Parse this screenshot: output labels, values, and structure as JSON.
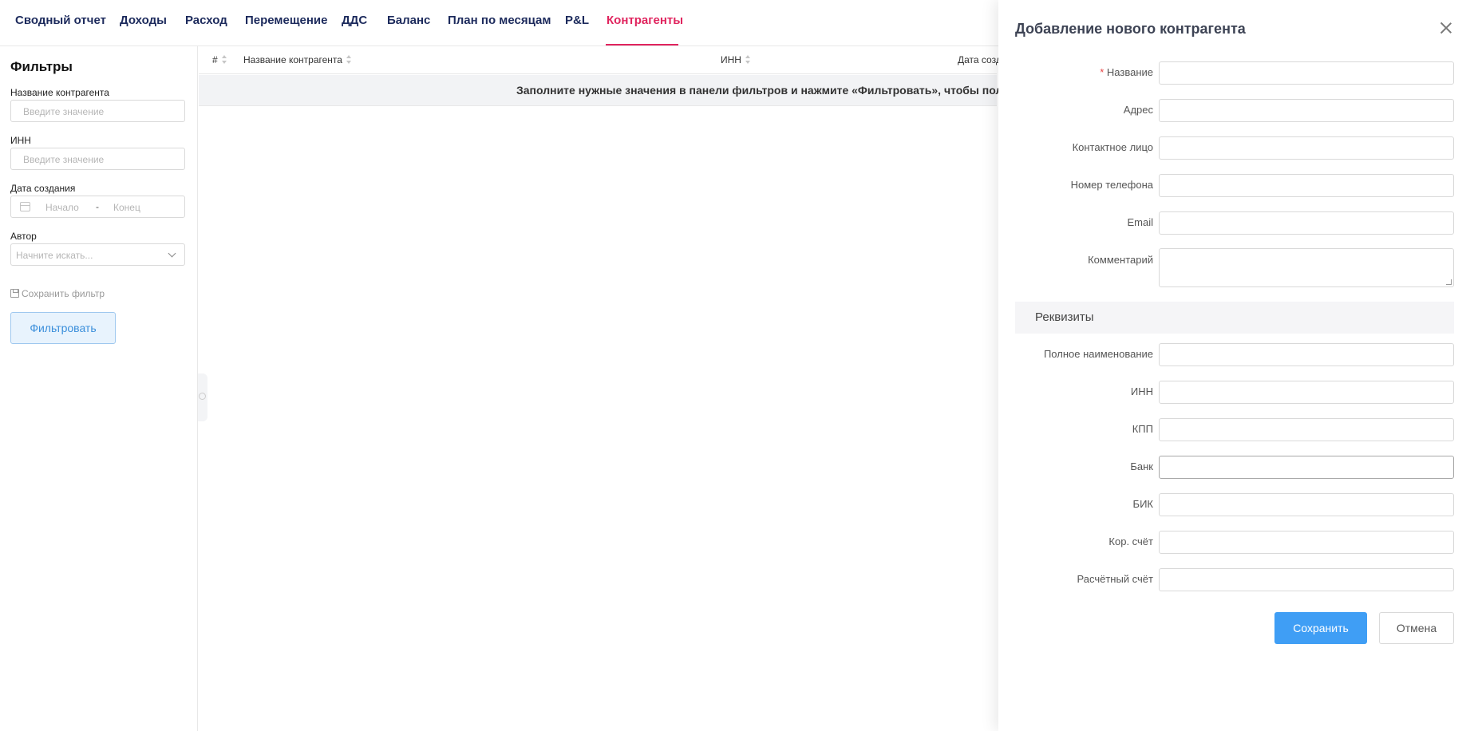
{
  "nav": {
    "tabs": [
      {
        "label": "Сводный отчет"
      },
      {
        "label": "Доходы"
      },
      {
        "label": "Расход"
      },
      {
        "label": "Перемещение"
      },
      {
        "label": "ДДС"
      },
      {
        "label": "Баланс"
      },
      {
        "label": "План по месяцам"
      },
      {
        "label": "P&L"
      },
      {
        "label": "Контрагенты"
      }
    ],
    "active_tab": "Контрагенты",
    "active_color": "#e0245e"
  },
  "filters": {
    "title": "Фильтры",
    "name_label": "Название контрагента",
    "name_placeholder": "Введите значение",
    "inn_label": "ИНН",
    "inn_placeholder": "Введите значение",
    "date_label": "Дата создания",
    "date_start_placeholder": "Начало",
    "date_separator": "-",
    "date_end_placeholder": "Конец",
    "author_label": "Автор",
    "author_placeholder": "Начните искать...",
    "save_filter_label": "Сохранить фильтр",
    "filter_button": "Фильтровать"
  },
  "table": {
    "columns": [
      "#",
      "Название контрагента",
      "ИНН",
      "Дата созд"
    ],
    "empty_message": "Заполните нужные значения в панели фильтров и нажмите «Фильтровать», чтобы пол"
  },
  "drawer": {
    "title": "Добавление нового контрагента",
    "required_mark": "*",
    "fields": [
      {
        "label": "Название",
        "value": ""
      },
      {
        "label": "Адрес",
        "value": ""
      },
      {
        "label": "Контактное лицо",
        "value": ""
      },
      {
        "label": "Номер телефона",
        "value": ""
      },
      {
        "label": "Email",
        "value": ""
      },
      {
        "label": "Комментарий",
        "value": ""
      }
    ],
    "section_title": "Реквизиты",
    "requisites": [
      {
        "label": "Полное наименование",
        "value": ""
      },
      {
        "label": "ИНН",
        "value": ""
      },
      {
        "label": "КПП",
        "value": ""
      },
      {
        "label": "Банк",
        "value": ""
      },
      {
        "label": "БИК",
        "value": ""
      },
      {
        "label": "Кор. счёт",
        "value": ""
      },
      {
        "label": "Расчётный счёт",
        "value": ""
      }
    ],
    "save_button": "Сохранить",
    "cancel_button": "Отмена",
    "primary_color": "#3f9ef5"
  }
}
